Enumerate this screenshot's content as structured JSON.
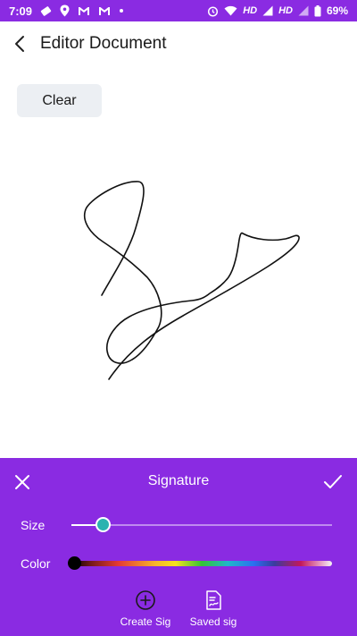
{
  "status_bar": {
    "time": "7:09",
    "network": "HD",
    "network2": "HD",
    "battery": "69%"
  },
  "header": {
    "title": "Editor Document",
    "back_icon": "chevron-left-icon"
  },
  "toolbar": {
    "clear_label": "Clear"
  },
  "signature_panel": {
    "title": "Signature",
    "close_icon": "close-icon",
    "confirm_icon": "check-icon",
    "size_label": "Size",
    "size_value": 0.12,
    "color_label": "Color",
    "selected_color": "#000000",
    "actions": [
      {
        "label": "Create Sig",
        "icon": "plus-circle-icon"
      },
      {
        "label": "Saved sig",
        "icon": "signature-document-icon"
      }
    ]
  },
  "colors": {
    "accent": "#8a2be2",
    "thumb": "#2bb3b0",
    "button_bg": "#eceff3"
  }
}
